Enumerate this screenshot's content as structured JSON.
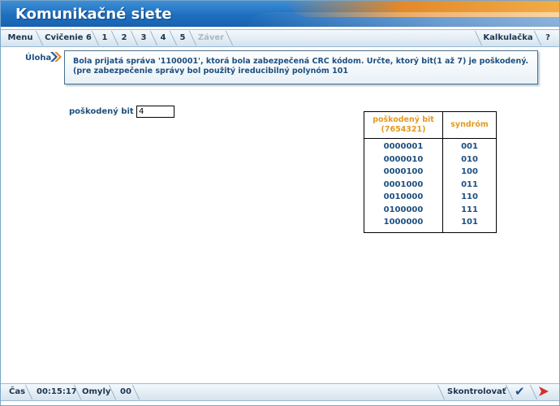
{
  "app": {
    "title": "Komunikačné siete"
  },
  "nav": {
    "menu": "Menu",
    "exercise": "Cvičenie 6",
    "steps": [
      "1",
      "2",
      "3",
      "4",
      "5"
    ],
    "zaver": "Záver",
    "calculator": "Kalkulačka",
    "help": "?"
  },
  "task": {
    "label": "Úloha",
    "text": "Bola prijatá správa '1100001', ktorá bola zabezpečená CRC kódom. Určte, ktorý bit(1 až 7) je poškodený. (pre zabezpečenie správy bol použitý ireducibilný polynóm 101"
  },
  "answer": {
    "label": "poškodený bit =",
    "value": "4"
  },
  "table": {
    "header_bit_line1": "poškodený bit",
    "header_bit_line2": "(7654321)",
    "header_syndrom": "syndróm",
    "bits": [
      "0000001",
      "0000010",
      "0000100",
      "0001000",
      "0010000",
      "0100000",
      "1000000"
    ],
    "syndromes": [
      "001",
      "010",
      "100",
      "011",
      "110",
      "111",
      "101"
    ]
  },
  "status": {
    "time_label": "Čas",
    "time_value": "00:15:17",
    "errors_label": "Omyly",
    "errors_value": "00",
    "check_button": "Skontrolovať"
  },
  "icons": {
    "check": "checkmark-icon",
    "next": "next-arrow-icon",
    "task": "double-chevron-icon"
  }
}
